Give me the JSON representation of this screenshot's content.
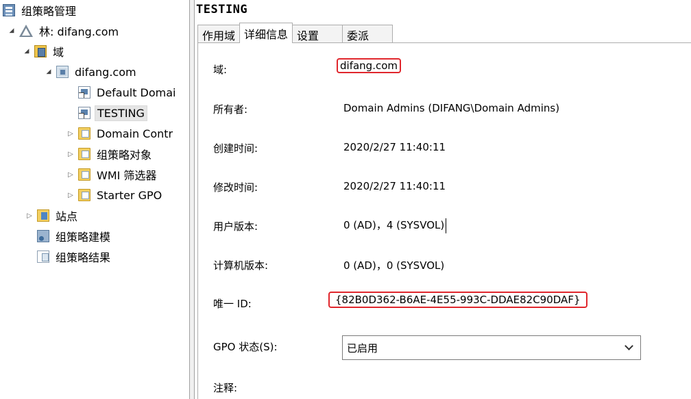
{
  "tree": {
    "root": {
      "label": "组策略管理",
      "icon": "gpm-icon"
    },
    "forest": {
      "label": "林: difang.com",
      "icon": "forest-icon"
    },
    "domains": {
      "label": "域",
      "icon": "domains-folder-icon"
    },
    "domain": {
      "label": "difang.com",
      "icon": "domain-icon"
    },
    "default_policy": {
      "label": "Default Domai",
      "icon": "gpo-link-icon"
    },
    "testing": {
      "label": "TESTING",
      "icon": "gpo-link-icon"
    },
    "domain_controllers": {
      "label": "Domain Contr",
      "icon": "ou-folder-icon"
    },
    "gpo_objects": {
      "label": "组策略对象",
      "icon": "gpo-folder-icon"
    },
    "wmi_filters": {
      "label": "WMI 筛选器",
      "icon": "wmi-folder-icon"
    },
    "starter_gpo": {
      "label": "Starter GPO",
      "icon": "starter-folder-icon"
    },
    "sites": {
      "label": "站点",
      "icon": "sites-folder-icon"
    },
    "modeling": {
      "label": "组策略建模",
      "icon": "modeling-icon"
    },
    "results": {
      "label": "组策略结果",
      "icon": "results-icon"
    }
  },
  "details": {
    "title": "TESTING",
    "tabs": [
      {
        "label": "作用域",
        "active": false
      },
      {
        "label": "详细信息",
        "active": true
      },
      {
        "label": "设置",
        "active": false
      },
      {
        "label": "委派",
        "active": false
      }
    ],
    "domain_label": "域:",
    "domain_value": "difang.com",
    "owner_label": "所有者:",
    "owner_value": "Domain Admins (DIFANG\\Domain Admins)",
    "created_label": "创建时间:",
    "created_value": "2020/2/27 11:40:11",
    "modified_label": "修改时间:",
    "modified_value": "2020/2/27 11:40:11",
    "user_version_label": "用户版本:",
    "user_version_value": "0 (AD)，4 (SYSVOL)",
    "computer_version_label": "计算机版本:",
    "computer_version_value": "0 (AD)，0 (SYSVOL)",
    "unique_id_label": "唯一 ID:",
    "unique_id_value": "{82B0D362-B6AE-4E55-993C-DDAE82C90DAF}",
    "gpo_status_label": "GPO 状态(S):",
    "gpo_status_value": "已启用",
    "comment_label": "注释:",
    "highlight_color": "#e0262c"
  }
}
